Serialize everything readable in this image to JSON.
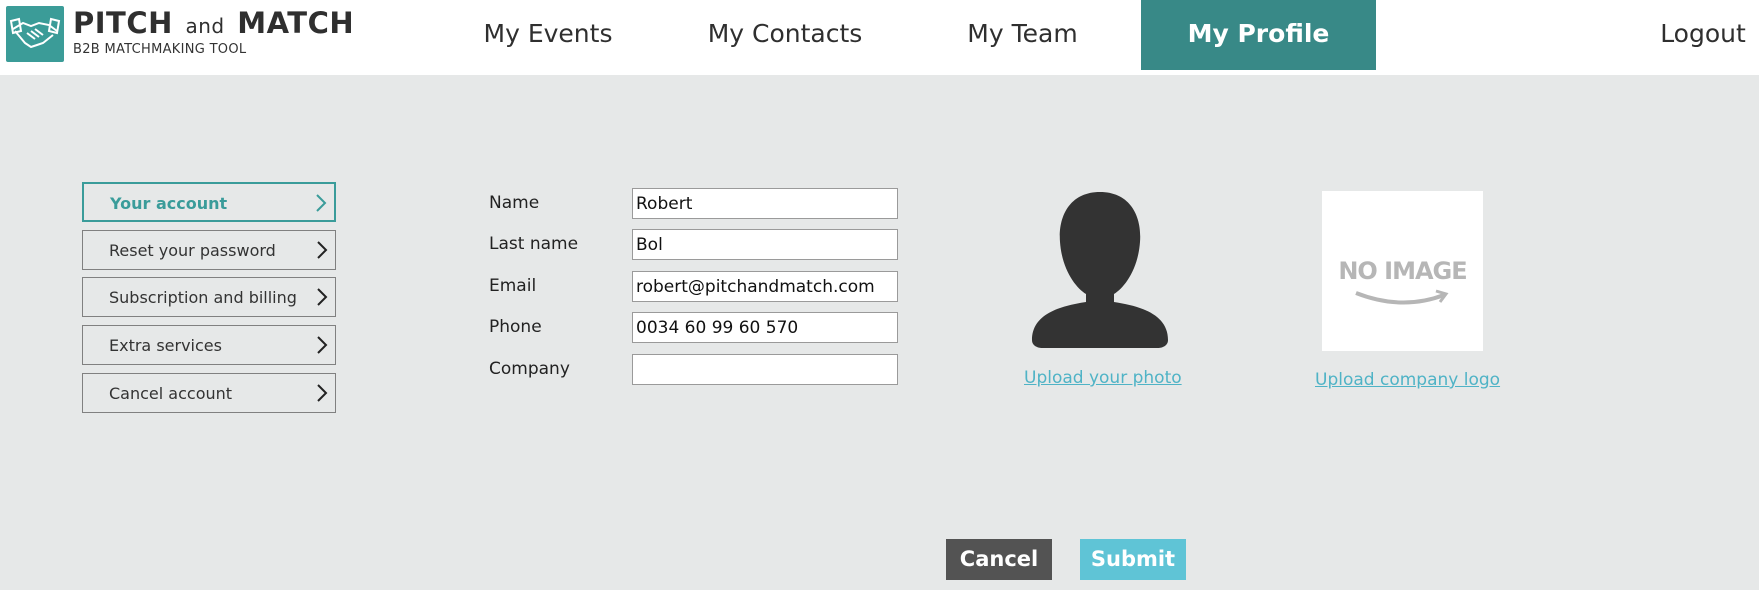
{
  "brand": {
    "name_part1": "PITCH",
    "name_and": "and",
    "name_part2": "MATCH",
    "tagline": "B2B MATCHMAKING TOOL"
  },
  "nav": {
    "items": [
      {
        "label": "My Events"
      },
      {
        "label": "My Contacts"
      },
      {
        "label": "My Team"
      },
      {
        "label": "My Profile",
        "active": true
      }
    ],
    "logout": "Logout"
  },
  "side_menu": {
    "items": [
      {
        "label": "Your account",
        "active": true
      },
      {
        "label": "Reset your password"
      },
      {
        "label": "Subscription and billing"
      },
      {
        "label": "Extra services"
      },
      {
        "label": "Cancel account"
      }
    ]
  },
  "form": {
    "fields": [
      {
        "label": "Name",
        "value": "Robert"
      },
      {
        "label": "Last name",
        "value": "Bol"
      },
      {
        "label": "Email",
        "value": "robert@pitchandmatch.com"
      },
      {
        "label": "Phone",
        "value": "0034 60 99 60 570"
      },
      {
        "label": "Company",
        "value": ""
      }
    ]
  },
  "photo": {
    "upload_label": "Upload your photo"
  },
  "company_logo": {
    "placeholder_text": "NO IMAGE",
    "upload_label": "Upload company logo"
  },
  "actions": {
    "cancel": "Cancel",
    "submit": "Submit"
  },
  "colors": {
    "accent": "#388987",
    "link": "#4fb3c6",
    "submit": "#5fc4d6",
    "cancel": "#535353",
    "background": "#e6e8e8"
  }
}
